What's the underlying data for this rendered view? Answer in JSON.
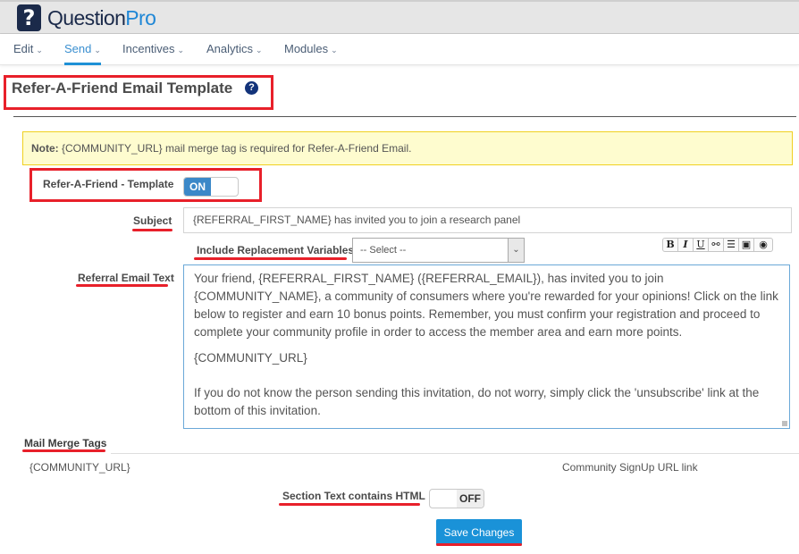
{
  "app": {
    "logo_mark": "?",
    "brand_part1": "Question",
    "brand_part2": "Pro",
    "brand_color": "#1f87d6"
  },
  "nav": {
    "items": [
      {
        "label": "Edit",
        "active": false
      },
      {
        "label": "Send",
        "active": true
      },
      {
        "label": "Incentives",
        "active": false
      },
      {
        "label": "Analytics",
        "active": false
      },
      {
        "label": "Modules",
        "active": false
      }
    ],
    "chevron": "⌄"
  },
  "page": {
    "title": "Refer-A-Friend Email Template",
    "help_icon": "?"
  },
  "note": {
    "label": "Note:",
    "text": " {COMMUNITY_URL} mail merge tag is required for Refer-A-Friend Email."
  },
  "form": {
    "template_toggle": {
      "label": "Refer-A-Friend - Template",
      "state": "ON"
    },
    "subject": {
      "label": "Subject",
      "value": "{REFERRAL_FIRST_NAME} has invited you to join a research panel"
    },
    "replacement": {
      "label": "Include Replacement Variables:",
      "selected": "-- Select --"
    },
    "toolbar": [
      {
        "name": "bold",
        "glyph": "B"
      },
      {
        "name": "italic",
        "glyph": "I"
      },
      {
        "name": "underline",
        "glyph": "U"
      },
      {
        "name": "link",
        "glyph": "⚯"
      },
      {
        "name": "align-center",
        "glyph": "☰"
      },
      {
        "name": "image",
        "glyph": "▣"
      },
      {
        "name": "preview",
        "glyph": "◉"
      }
    ],
    "email_text": {
      "label": "Referral Email Text",
      "paragraphs": [
        "Your friend, {REFERRAL_FIRST_NAME} ({REFERRAL_EMAIL}), has invited you to join {COMMUNITY_NAME}, a community of consumers where you're rewarded for your opinions! Click on the link below to register and earn 10 bonus points. Remember, you must confirm your registration and proceed to complete your community profile in order to access the member area and earn more points.",
        "{COMMUNITY_URL}",
        "If you do not know the person sending this invitation, do not worry, simply click the 'unsubscribe' link at the bottom of this invitation."
      ]
    }
  },
  "mail_merge": {
    "title": "Mail Merge Tags",
    "tags": [
      {
        "tag": "{COMMUNITY_URL}",
        "description": "Community SignUp URL link"
      }
    ]
  },
  "html_toggle": {
    "label": "Section Text contains HTML",
    "state": "OFF"
  },
  "save_label": "Save Changes",
  "colors": {
    "accent": "#1a92d8",
    "annotation_red": "#e8202a",
    "note_bg": "#fefccf"
  }
}
